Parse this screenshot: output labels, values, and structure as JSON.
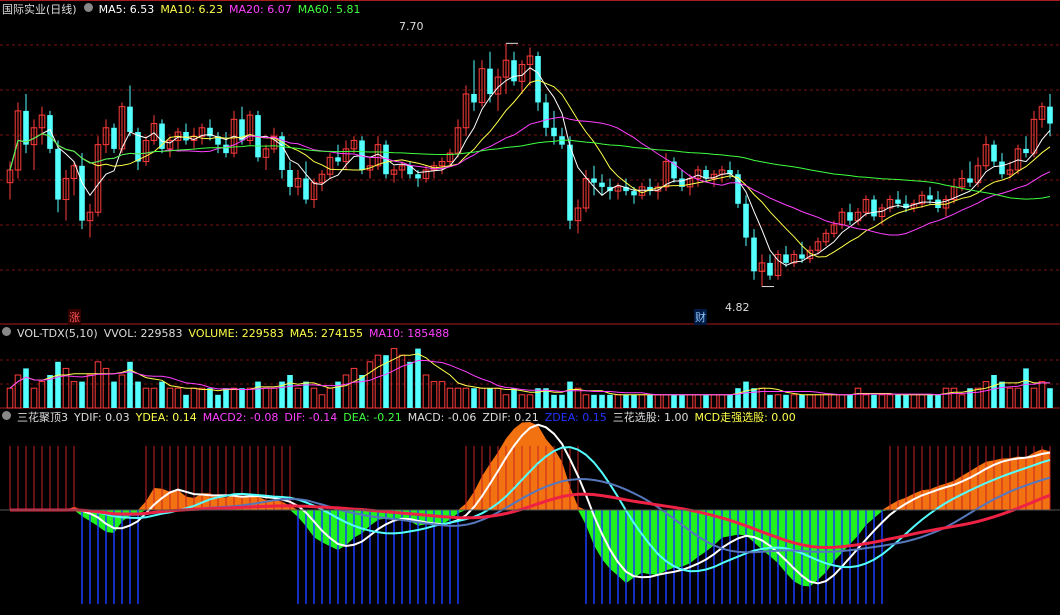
{
  "colors": {
    "up": "#ff3b3b",
    "down": "#54ffff",
    "ma5": "#ffffff",
    "ma10": "#ffff4a",
    "ma20": "#ff40ff",
    "ma60": "#40ff40",
    "grid": "#7a1010",
    "panel_border": "#aa1b1b",
    "zdea": "#2233ff",
    "orange": "#ff7711",
    "green": "#22ff22",
    "blue_bar": "#1a3cff"
  },
  "price_panel": {
    "title": "国际实业(日线)",
    "ma": [
      {
        "label": "MA5: 6.53",
        "color": "#ffffff"
      },
      {
        "label": "MA10: 6.23",
        "color": "#ffff4a"
      },
      {
        "label": "MA20: 6.07",
        "color": "#ff40ff"
      },
      {
        "label": "MA60: 5.81",
        "color": "#40ff40"
      }
    ],
    "high_label": "7.70",
    "low_label": "4.82",
    "marker_up": "涨",
    "marker_cai": "财"
  },
  "volume_panel": {
    "labels": [
      {
        "text": "VOL-TDX(5,10)",
        "color": "#dddddd"
      },
      {
        "text": "VVOL: 229583",
        "color": "#dddddd"
      },
      {
        "text": "VOLUME: 229583",
        "color": "#ffff4a"
      },
      {
        "text": "MA5: 274155",
        "color": "#ffff4a"
      },
      {
        "text": "MA10: 185488",
        "color": "#ff40ff"
      }
    ]
  },
  "indicator_panel": {
    "labels": [
      {
        "text": "三花聚顶3",
        "color": "#dddddd"
      },
      {
        "text": "YDIF: 0.03",
        "color": "#dddddd"
      },
      {
        "text": "YDEA: 0.14",
        "color": "#ffff4a"
      },
      {
        "text": "MACD2: -0.08",
        "color": "#ff40ff"
      },
      {
        "text": "DIF: -0.14",
        "color": "#ff40ff"
      },
      {
        "text": "DEA: -0.21",
        "color": "#40ff40"
      },
      {
        "text": "MACD: -0.06",
        "color": "#dddddd"
      },
      {
        "text": "ZDIF: 0.21",
        "color": "#dddddd"
      },
      {
        "text": "ZDEA: 0.15",
        "color": "#2233ff"
      },
      {
        "text": "三花选股: 1.00",
        "color": "#dddddd"
      },
      {
        "text": "MCD走强选股: 0.00",
        "color": "#ffff4a"
      }
    ]
  },
  "chart_data": {
    "type": "candlestick",
    "y_range": [
      4.4,
      8.0
    ],
    "candles": [
      [
        6.05,
        6.3,
        5.85,
        6.2
      ],
      [
        6.2,
        7.0,
        6.1,
        6.9
      ],
      [
        6.9,
        7.1,
        6.4,
        6.5
      ],
      [
        6.5,
        6.8,
        6.2,
        6.7
      ],
      [
        6.7,
        6.95,
        6.5,
        6.85
      ],
      [
        6.85,
        6.9,
        6.4,
        6.45
      ],
      [
        6.45,
        6.55,
        5.7,
        5.85
      ],
      [
        5.85,
        6.2,
        5.6,
        6.1
      ],
      [
        6.1,
        6.3,
        5.9,
        6.25
      ],
      [
        6.25,
        6.4,
        5.5,
        5.6
      ],
      [
        5.6,
        5.8,
        5.4,
        5.7
      ],
      [
        5.7,
        6.6,
        5.65,
        6.5
      ],
      [
        6.5,
        6.8,
        6.4,
        6.7
      ],
      [
        6.7,
        6.75,
        6.4,
        6.45
      ],
      [
        6.45,
        7.0,
        6.4,
        6.95
      ],
      [
        6.95,
        7.2,
        6.6,
        6.65
      ],
      [
        6.65,
        6.7,
        6.2,
        6.3
      ],
      [
        6.3,
        6.6,
        6.25,
        6.55
      ],
      [
        6.55,
        6.85,
        6.5,
        6.75
      ],
      [
        6.75,
        6.8,
        6.4,
        6.45
      ],
      [
        6.45,
        6.6,
        6.35,
        6.55
      ],
      [
        6.55,
        6.7,
        6.45,
        6.65
      ],
      [
        6.65,
        6.75,
        6.5,
        6.55
      ],
      [
        6.55,
        6.7,
        6.45,
        6.6
      ],
      [
        6.6,
        6.75,
        6.5,
        6.7
      ],
      [
        6.7,
        6.8,
        6.55,
        6.6
      ],
      [
        6.6,
        6.65,
        6.4,
        6.5
      ],
      [
        6.5,
        6.65,
        6.35,
        6.4
      ],
      [
        6.4,
        6.9,
        6.35,
        6.8
      ],
      [
        6.8,
        6.95,
        6.5,
        6.55
      ],
      [
        6.55,
        6.9,
        6.5,
        6.85
      ],
      [
        6.85,
        6.9,
        6.3,
        6.35
      ],
      [
        6.35,
        6.5,
        6.2,
        6.45
      ],
      [
        6.45,
        6.7,
        6.4,
        6.6
      ],
      [
        6.6,
        6.65,
        6.1,
        6.2
      ],
      [
        6.2,
        6.3,
        5.9,
        6.0
      ],
      [
        6.0,
        6.2,
        5.9,
        6.1
      ],
      [
        6.1,
        6.3,
        5.8,
        5.85
      ],
      [
        5.85,
        6.1,
        5.75,
        6.05
      ],
      [
        6.05,
        6.2,
        5.95,
        6.15
      ],
      [
        6.15,
        6.4,
        6.1,
        6.35
      ],
      [
        6.35,
        6.5,
        6.25,
        6.3
      ],
      [
        6.3,
        6.55,
        6.2,
        6.45
      ],
      [
        6.45,
        6.6,
        6.4,
        6.55
      ],
      [
        6.55,
        6.6,
        6.15,
        6.2
      ],
      [
        6.2,
        6.35,
        6.1,
        6.25
      ],
      [
        6.25,
        6.6,
        6.2,
        6.5
      ],
      [
        6.5,
        6.55,
        6.1,
        6.15
      ],
      [
        6.15,
        6.25,
        6.05,
        6.2
      ],
      [
        6.2,
        6.3,
        6.1,
        6.25
      ],
      [
        6.25,
        6.3,
        6.1,
        6.15
      ],
      [
        6.15,
        6.2,
        6.0,
        6.1
      ],
      [
        6.1,
        6.25,
        6.05,
        6.2
      ],
      [
        6.2,
        6.3,
        6.1,
        6.25
      ],
      [
        6.25,
        6.35,
        6.15,
        6.3
      ],
      [
        6.3,
        6.45,
        6.25,
        6.4
      ],
      [
        6.4,
        6.8,
        6.35,
        6.7
      ],
      [
        6.7,
        7.2,
        6.6,
        7.1
      ],
      [
        7.1,
        7.5,
        6.9,
        7.0
      ],
      [
        7.0,
        7.5,
        6.95,
        7.4
      ],
      [
        7.4,
        7.6,
        7.0,
        7.1
      ],
      [
        7.1,
        7.4,
        6.9,
        7.3
      ],
      [
        7.3,
        7.7,
        7.1,
        7.5
      ],
      [
        7.5,
        7.6,
        7.2,
        7.25
      ],
      [
        7.25,
        7.5,
        7.1,
        7.45
      ],
      [
        7.45,
        7.65,
        7.2,
        7.55
      ],
      [
        7.55,
        7.6,
        6.9,
        7.0
      ],
      [
        7.0,
        7.1,
        6.6,
        6.7
      ],
      [
        6.7,
        6.9,
        6.5,
        6.6
      ],
      [
        6.6,
        6.7,
        6.45,
        6.5
      ],
      [
        6.5,
        6.6,
        5.5,
        5.6
      ],
      [
        5.6,
        5.85,
        5.45,
        5.75
      ],
      [
        5.75,
        6.2,
        5.7,
        6.1
      ],
      [
        6.1,
        6.25,
        5.9,
        6.05
      ],
      [
        6.05,
        6.15,
        5.9,
        6.0
      ],
      [
        6.0,
        6.1,
        5.85,
        5.95
      ],
      [
        5.95,
        6.05,
        5.85,
        6.0
      ],
      [
        6.0,
        6.1,
        5.9,
        5.95
      ],
      [
        5.95,
        6.0,
        5.8,
        5.9
      ],
      [
        5.9,
        6.05,
        5.85,
        6.0
      ],
      [
        6.0,
        6.1,
        5.9,
        5.95
      ],
      [
        5.95,
        6.05,
        5.85,
        6.0
      ],
      [
        6.0,
        6.4,
        5.95,
        6.3
      ],
      [
        6.3,
        6.35,
        6.05,
        6.1
      ],
      [
        6.1,
        6.2,
        5.95,
        6.0
      ],
      [
        6.0,
        6.15,
        5.9,
        6.1
      ],
      [
        6.1,
        6.25,
        6.0,
        6.2
      ],
      [
        6.2,
        6.25,
        6.05,
        6.1
      ],
      [
        6.1,
        6.2,
        6.0,
        6.15
      ],
      [
        6.15,
        6.25,
        6.05,
        6.2
      ],
      [
        6.2,
        6.3,
        6.1,
        6.15
      ],
      [
        6.15,
        6.2,
        5.75,
        5.8
      ],
      [
        5.8,
        5.9,
        5.3,
        5.4
      ],
      [
        5.4,
        5.5,
        4.9,
        5.0
      ],
      [
        5.0,
        5.2,
        4.82,
        5.1
      ],
      [
        5.1,
        5.2,
        4.9,
        4.95
      ],
      [
        4.95,
        5.25,
        4.9,
        5.2
      ],
      [
        5.2,
        5.3,
        5.05,
        5.1
      ],
      [
        5.1,
        5.25,
        5.05,
        5.2
      ],
      [
        5.2,
        5.35,
        5.1,
        5.15
      ],
      [
        5.15,
        5.3,
        5.1,
        5.25
      ],
      [
        5.25,
        5.4,
        5.2,
        5.35
      ],
      [
        5.35,
        5.5,
        5.3,
        5.45
      ],
      [
        5.45,
        5.6,
        5.4,
        5.55
      ],
      [
        5.55,
        5.75,
        5.5,
        5.7
      ],
      [
        5.7,
        5.8,
        5.55,
        5.6
      ],
      [
        5.6,
        5.75,
        5.55,
        5.7
      ],
      [
        5.7,
        5.9,
        5.65,
        5.85
      ],
      [
        5.85,
        5.9,
        5.6,
        5.65
      ],
      [
        5.65,
        5.8,
        5.55,
        5.75
      ],
      [
        5.75,
        5.9,
        5.7,
        5.85
      ],
      [
        5.85,
        5.95,
        5.75,
        5.8
      ],
      [
        5.8,
        5.9,
        5.7,
        5.75
      ],
      [
        5.75,
        5.85,
        5.7,
        5.8
      ],
      [
        5.8,
        5.95,
        5.75,
        5.9
      ],
      [
        5.9,
        6.0,
        5.8,
        5.85
      ],
      [
        5.85,
        5.95,
        5.7,
        5.75
      ],
      [
        5.75,
        5.9,
        5.65,
        5.85
      ],
      [
        5.85,
        6.1,
        5.8,
        6.0
      ],
      [
        6.0,
        6.2,
        5.95,
        6.1
      ],
      [
        6.1,
        6.3,
        6.0,
        6.05
      ],
      [
        6.05,
        6.35,
        6.0,
        6.25
      ],
      [
        6.25,
        6.6,
        6.2,
        6.5
      ],
      [
        6.5,
        6.55,
        6.25,
        6.3
      ],
      [
        6.3,
        6.4,
        6.1,
        6.15
      ],
      [
        6.15,
        6.3,
        6.1,
        6.2
      ],
      [
        6.2,
        6.5,
        6.15,
        6.45
      ],
      [
        6.45,
        6.6,
        6.35,
        6.4
      ],
      [
        6.4,
        6.9,
        6.35,
        6.8
      ],
      [
        6.8,
        7.0,
        6.7,
        6.95
      ],
      [
        6.95,
        7.1,
        6.6,
        6.75
      ]
    ],
    "volume": [
      3,
      5,
      6,
      3,
      4,
      5,
      7,
      6,
      4,
      4,
      5,
      7,
      6,
      4,
      5,
      7,
      4,
      3,
      3,
      4,
      3,
      3,
      2,
      3,
      3,
      3,
      2,
      3,
      3,
      3,
      3,
      4,
      3,
      3,
      4,
      5,
      3,
      4,
      3,
      2,
      3,
      4,
      5,
      6,
      5,
      7,
      8,
      8,
      9,
      8,
      7,
      9,
      5,
      4,
      4,
      3,
      3,
      3,
      3,
      3,
      3,
      3,
      2,
      3,
      2,
      2,
      3,
      3,
      2,
      2,
      4,
      3,
      2,
      2,
      2,
      2,
      2,
      2,
      2,
      2,
      2,
      2,
      2,
      2,
      2,
      2,
      2,
      2,
      2,
      2,
      2,
      3,
      4,
      3,
      3,
      2,
      2,
      2,
      2,
      2,
      2,
      2,
      2,
      2,
      2,
      2,
      3,
      2,
      2,
      2,
      2,
      2,
      2,
      2,
      2,
      2,
      2,
      3,
      3,
      2,
      3,
      3,
      4,
      5,
      4,
      3,
      3,
      6,
      3,
      4,
      3
    ],
    "vol_max": 10
  }
}
